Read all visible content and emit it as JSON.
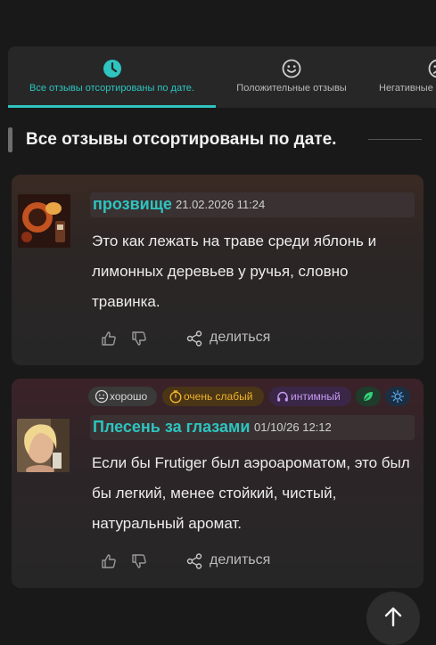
{
  "tabs": [
    {
      "label": "Все отзывы отсортированы по дате.",
      "icon": "clock-icon",
      "active": true
    },
    {
      "label": "Положительные отзывы",
      "icon": "smile-icon",
      "active": false
    },
    {
      "label": "Негативные отзывы",
      "icon": "frown-icon",
      "active": false
    }
  ],
  "section": {
    "title": "Все отзывы отсортированы по дате."
  },
  "reviews": [
    {
      "username": "прозвище",
      "date": "21.02.2026 11:24",
      "text": "Это как лежать на траве среди яблонь и лимонных деревьев у ручья, словно травинка.",
      "share_label": "делиться",
      "tags": []
    },
    {
      "username": "Плесень за глазами",
      "date": "01/10/26 12:12",
      "text": "Если бы Frutiger был аэроароматом, это был бы легкий, менее стойкий, чистый, натуральный аромат.",
      "share_label": "делиться",
      "tags": [
        {
          "label": "хорошо",
          "icon": "neutral-face-icon",
          "color": "#d8d8d8"
        },
        {
          "label": "очень слабый",
          "icon": "timer-icon",
          "color": "#f0b429"
        },
        {
          "label": "интимный",
          "icon": "headphones-icon",
          "color": "#c79af0"
        },
        {
          "label": "",
          "icon": "leaf-icon",
          "color": "#33d17a"
        },
        {
          "label": "",
          "icon": "sun-icon",
          "color": "#5aa9f0"
        }
      ]
    }
  ],
  "colors": {
    "accent": "#2ec4c0",
    "background": "#191919",
    "card": "#262626"
  }
}
